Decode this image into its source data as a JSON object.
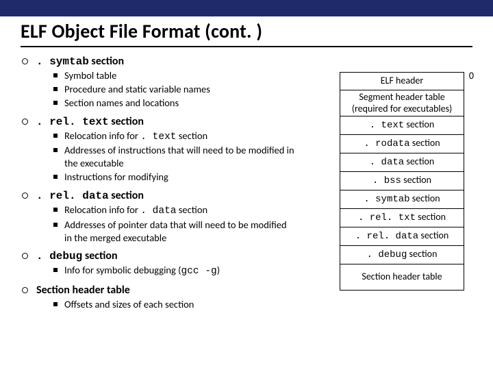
{
  "title": "ELF Object File Format (cont. )",
  "sections": [
    {
      "heading_code": ". symtab",
      "heading_rest": " section",
      "items": [
        "Symbol table",
        "Procedure and static variable names",
        "Section names and locations"
      ]
    },
    {
      "heading_code": ". rel. text",
      "heading_rest": " section",
      "items": [
        "Relocation info for . text section",
        "Addresses of instructions that will need to be modified in the executable",
        "Instructions for modifying"
      ]
    },
    {
      "heading_code": ". rel. data",
      "heading_rest": " section",
      "items": [
        "Relocation info for . data section",
        "Addresses of pointer data that will need to be modified in the merged executable"
      ]
    },
    {
      "heading_code": ". debug",
      "heading_rest": " section",
      "items": [
        "Info for symbolic debugging (gcc -g)"
      ]
    },
    {
      "heading_code": "",
      "heading_rest": "Section header table",
      "items": [
        "Offsets and sizes of each section"
      ]
    }
  ],
  "diagram": {
    "zero": "0",
    "cells": [
      {
        "text": "ELF header",
        "h": "single"
      },
      {
        "text": "Segment header table (required for executables)",
        "h": "double"
      },
      {
        "text": ". text section",
        "h": "single",
        "mono_prefix": ". text",
        "suffix": " section"
      },
      {
        "text": ". rodata section",
        "h": "single",
        "mono_prefix": ". rodata",
        "suffix": " section"
      },
      {
        "text": ". data section",
        "h": "single",
        "mono_prefix": ". data",
        "suffix": " section"
      },
      {
        "text": ". bss section",
        "h": "single",
        "mono_prefix": ". bss",
        "suffix": " section"
      },
      {
        "text": ". symtab  section",
        "h": "single",
        "mono_prefix": ". symtab",
        "suffix": "  section"
      },
      {
        "text": ". rel. txt  section",
        "h": "single",
        "mono_prefix": ". rel. txt",
        "suffix": "  section"
      },
      {
        "text": ". rel. data  section",
        "h": "single",
        "mono_prefix": ". rel. data",
        "suffix": "  section"
      },
      {
        "text": ". debug  section",
        "h": "single",
        "mono_prefix": ". debug",
        "suffix": "  section"
      },
      {
        "text": "Section header table",
        "h": "double"
      }
    ]
  }
}
